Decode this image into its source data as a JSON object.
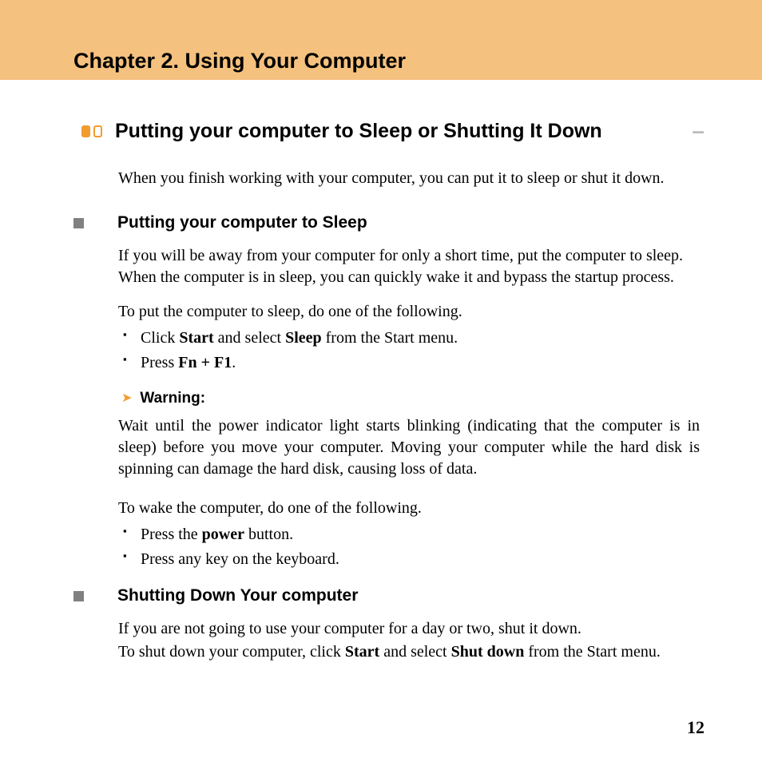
{
  "chapter_title": "Chapter 2. Using Your Computer",
  "section": {
    "title": "Putting your computer to Sleep or Shutting It Down",
    "intro": "When you finish working with your computer, you can put it to sleep or shut it down."
  },
  "sleep": {
    "heading": "Putting your computer to Sleep",
    "para1": "If you will be away from your computer for only a short time, put the computer to sleep. When the computer is in sleep, you can quickly wake it and bypass the startup process.",
    "lead": "To put the computer to sleep, do one of the following.",
    "items": {
      "a_pre": "Click ",
      "a_b1": "Start",
      "a_mid": " and select ",
      "a_b2": "Sleep",
      "a_post": " from the Start menu.",
      "b_pre": "Press ",
      "b_b": "Fn + F1",
      "b_post": "."
    },
    "warning_label": "Warning:",
    "warning_body": "Wait until the power indicator light starts blinking (indicating that the computer is in sleep) before you move your computer. Moving your computer while the hard disk is spinning can damage the hard disk, causing loss of data.",
    "wake_lead": "To wake the computer, do one of the following.",
    "wake_items": {
      "a_pre": "Press the ",
      "a_b": "power",
      "a_post": " button.",
      "b": "Press any key on the keyboard."
    }
  },
  "shutdown": {
    "heading": "Shutting Down Your computer",
    "para1": "If you are not going to use your computer for a day or two, shut it down.",
    "para2_pre": "To shut down your computer, click ",
    "para2_b1": "Start",
    "para2_mid": " and select ",
    "para2_b2": "Shut down",
    "para2_post": " from the Start menu."
  },
  "page_number": "12"
}
